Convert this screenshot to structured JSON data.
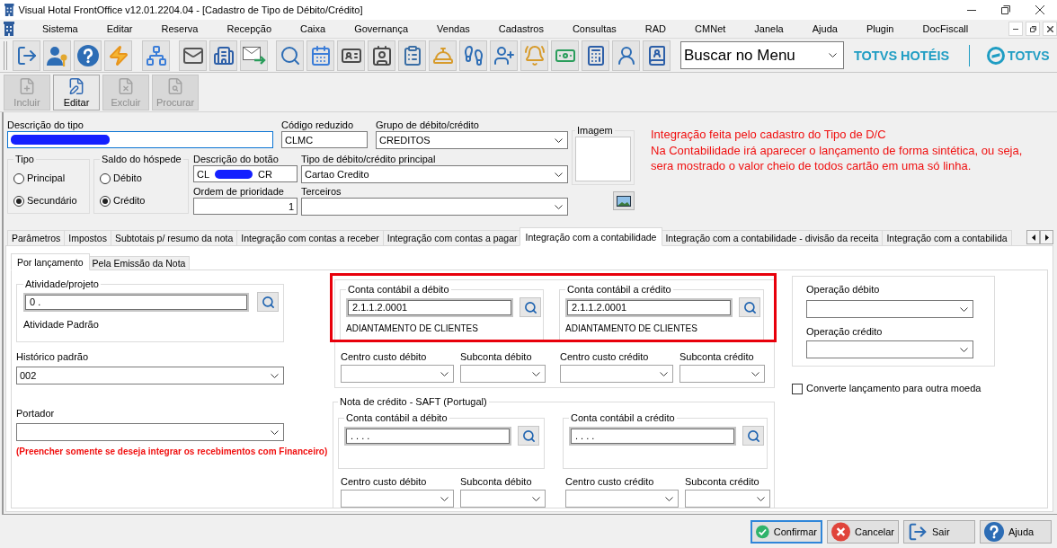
{
  "window": {
    "title": "Visual Hotal FrontOffice v12.01.2204.04 - [Cadastro de Tipo de Débito/Crédito]"
  },
  "menu": [
    "Sistema",
    "Editar",
    "Reserva",
    "Recepção",
    "Caixa",
    "Governança",
    "Vendas",
    "Cadastros",
    "Consultas",
    "RAD",
    "CMNet",
    "Janela",
    "Ajuda",
    "Plugin",
    "DocFiscall"
  ],
  "toolbar": {
    "search": {
      "value": "Buscar no Menu"
    },
    "brand": "TOTVS HOTÉIS",
    "logo_text": "TOTVS"
  },
  "record_buttons": [
    {
      "label": "Incluir",
      "kind": "add",
      "disabled": true
    },
    {
      "label": "Editar",
      "kind": "edit",
      "disabled": false
    },
    {
      "label": "Excluir",
      "kind": "delete",
      "disabled": true
    },
    {
      "label": "Procurar",
      "kind": "find",
      "disabled": true
    }
  ],
  "header": {
    "descricao_tipo": {
      "label": "Descrição do tipo",
      "focused": true,
      "redacted": true
    },
    "codigo_reduzido": {
      "label": "Código reduzido",
      "value": "CLMC"
    },
    "grupo": {
      "label": "Grupo de débito/crédito",
      "value": "CREDITOS"
    },
    "tipo": {
      "label": "Tipo",
      "options": [
        {
          "label": "Principal",
          "selected": false
        },
        {
          "label": "Secundário",
          "selected": true
        }
      ]
    },
    "saldo": {
      "label": "Saldo do hóspede",
      "options": [
        {
          "label": "Débito",
          "selected": false
        },
        {
          "label": "Crédito",
          "selected": true
        }
      ]
    },
    "descricao_botao": {
      "label": "Descrição do botão",
      "value_parts": [
        "CL",
        "CR"
      ],
      "redacted": true
    },
    "tipo_principal": {
      "label": "Tipo de débito/crédito principal",
      "value": "Cartao Credito"
    },
    "ordem": {
      "label": "Ordem de prioridade",
      "value": "1"
    },
    "terceiros": {
      "label": "Terceiros"
    },
    "imagem": {
      "label": "Imagem"
    },
    "note": [
      "Integração feita pelo cadastro do Tipo de D/C",
      "Na Contabilidade irá aparecer o lançamento de forma sintética, ou seja,",
      "sera mostrado o valor cheio de todos cartão em uma só linha."
    ]
  },
  "tabs": [
    {
      "label": "Parâmetros",
      "selected": false
    },
    {
      "label": "Impostos",
      "selected": false
    },
    {
      "label": "Subtotais p/ resumo da nota",
      "selected": false
    },
    {
      "label": "Integração com contas a receber",
      "selected": false
    },
    {
      "label": "Integração com contas a pagar",
      "selected": false
    },
    {
      "label": "Integração com a contabilidade",
      "selected": true
    },
    {
      "label": "Integração com a contabilidade - divisão da receita",
      "selected": false
    },
    {
      "label": "Integração com a contabilida",
      "selected": false
    }
  ],
  "subtabs": [
    {
      "label": "Por lançamento",
      "selected": true
    },
    {
      "label": "Pela Emissão da Nota",
      "selected": false
    }
  ],
  "panel": {
    "atividade": {
      "label": "Atividade/projeto",
      "value": "0 .",
      "description": "Atividade Padrão"
    },
    "historico": {
      "label": "Histórico padrão",
      "value": "002"
    },
    "portador": {
      "label": "Portador"
    },
    "warning": "(Preencher somente se deseja integrar os recebimentos com Financeiro)",
    "contas": {
      "highlighted": true,
      "accounts": [
        {
          "label": "Conta contábil a débito",
          "value": "2.1.1.2.0001",
          "description": "ADIANTAMENTO DE CLIENTES"
        },
        {
          "label": "Conta contábil a crédito",
          "value": "2.1.1.2.0001",
          "description": "ADIANTAMENTO DE CLIENTES"
        }
      ],
      "combos": [
        {
          "label": "Centro custo débito"
        },
        {
          "label": "Subconta débito"
        },
        {
          "label": "Centro custo crédito"
        },
        {
          "label": "Subconta crédito"
        }
      ]
    },
    "saft": {
      "title": "Nota de crédito - SAFT (Portugal)",
      "accounts": [
        {
          "label": "Conta contábil a débito",
          "value": ". . . ."
        },
        {
          "label": "Conta contábil a crédito",
          "value": ". . . ."
        }
      ],
      "combos": [
        {
          "label": "Centro custo débito"
        },
        {
          "label": "Subconta débito"
        },
        {
          "label": "Centro custo crédito"
        },
        {
          "label": "Subconta crédito"
        }
      ]
    },
    "operacoes": [
      {
        "label": "Operação débito"
      },
      {
        "label": "Operação crédito"
      }
    ],
    "converte": {
      "label": "Converte lançamento para outra moeda",
      "checked": false
    }
  },
  "footer_buttons": [
    {
      "label": "Confirmar",
      "kind": "confirm",
      "focused": true
    },
    {
      "label": "Cancelar",
      "kind": "cancel",
      "focused": false
    },
    {
      "label": "Sair",
      "kind": "exit",
      "focused": false
    },
    {
      "label": "Ajuda",
      "kind": "help",
      "focused": false
    }
  ]
}
